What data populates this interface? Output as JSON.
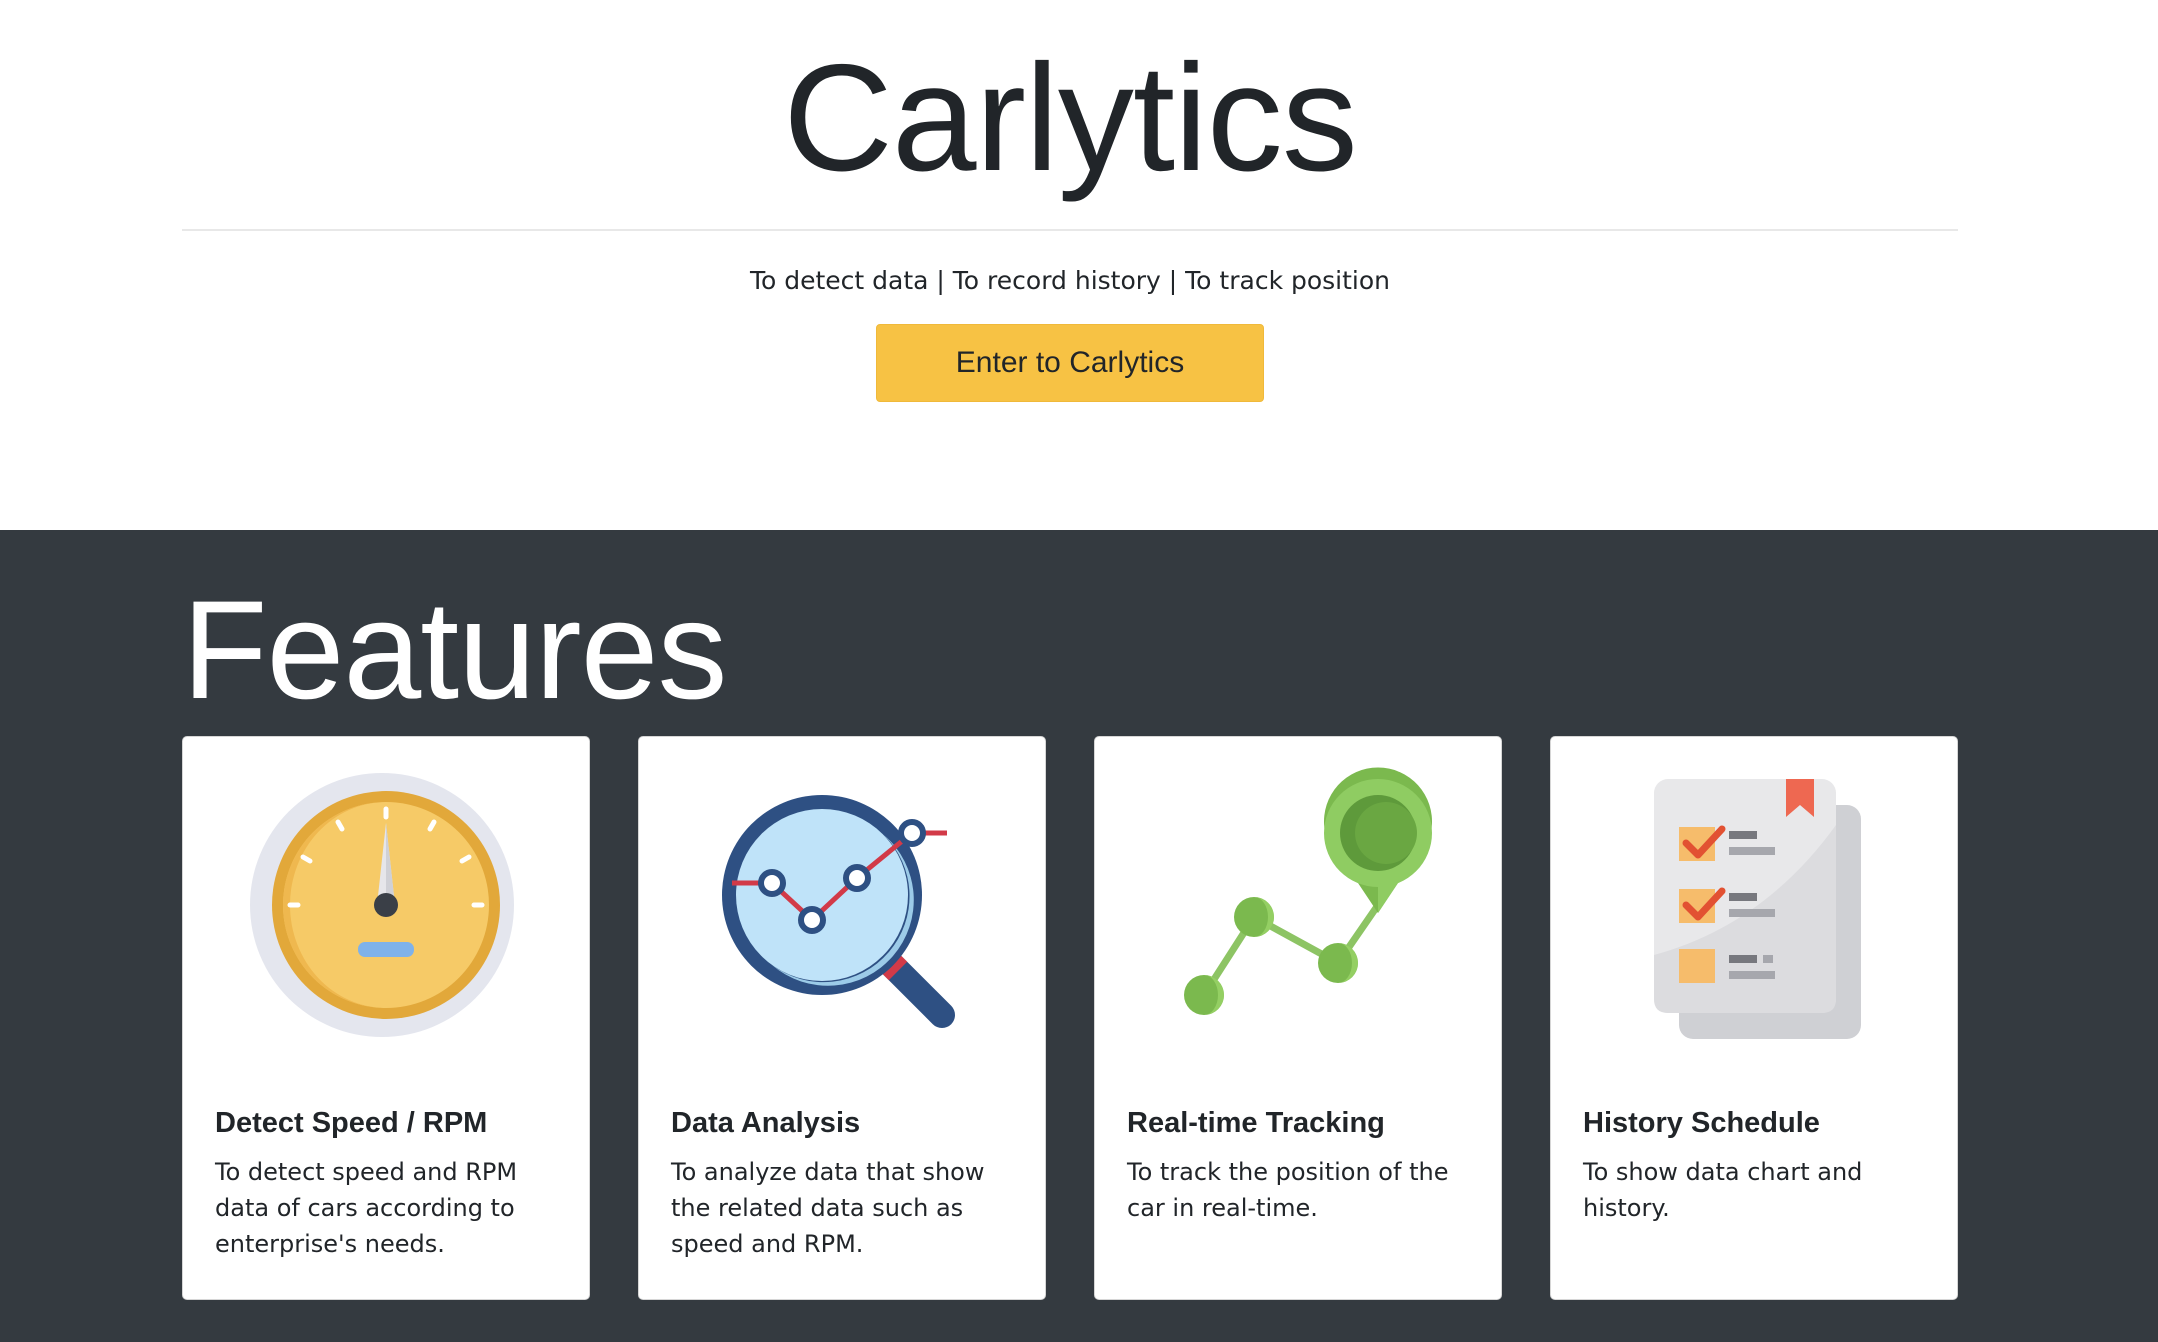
{
  "hero": {
    "title": "Carlytics",
    "tagline": "To detect data | To record history | To track position",
    "button_label": "Enter to Carlytics"
  },
  "features": {
    "title": "Features",
    "cards": [
      {
        "icon": "speedometer-icon",
        "title": "Detect Speed / RPM",
        "text": "To detect speed and RPM data of cars according to enterprise's needs."
      },
      {
        "icon": "magnifier-chart-icon",
        "title": "Data Analysis",
        "text": "To analyze data that show the related data such as speed and RPM."
      },
      {
        "icon": "map-pin-route-icon",
        "title": "Real-time Tracking",
        "text": "To track the position of the car in real-time."
      },
      {
        "icon": "checklist-document-icon",
        "title": "History Schedule",
        "text": "To show data chart and history."
      }
    ]
  },
  "colors": {
    "accent": "#f7c244",
    "dark_section": "#343a40",
    "text": "#212529"
  }
}
